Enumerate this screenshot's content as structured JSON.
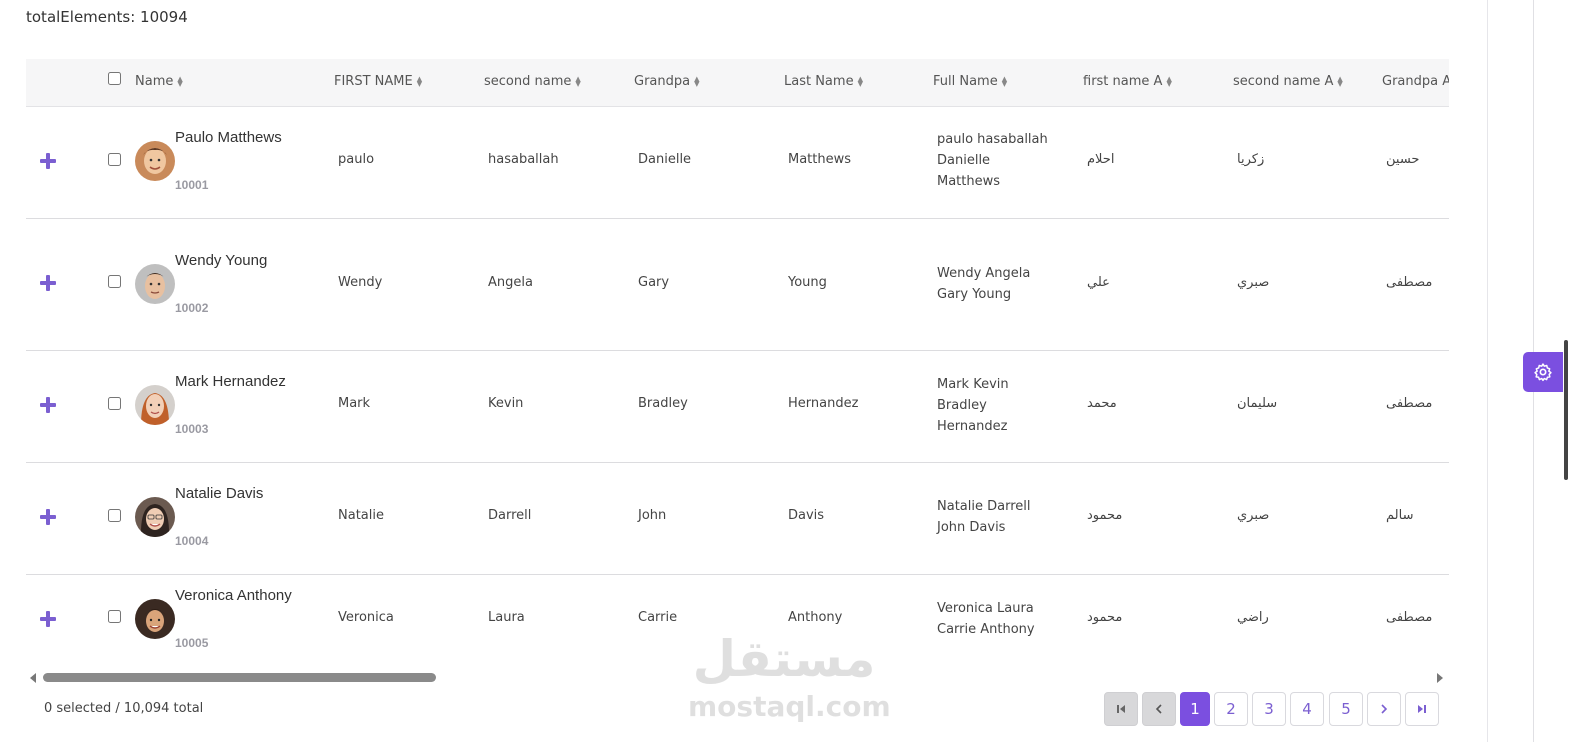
{
  "summary": {
    "total_elements": "totalElements: 10094"
  },
  "table": {
    "columns": [
      {
        "label": "Name"
      },
      {
        "label": "FIRST NAME"
      },
      {
        "label": "second name"
      },
      {
        "label": "Grandpa"
      },
      {
        "label": "Last Name"
      },
      {
        "label": "Full Name"
      },
      {
        "label": "first name A"
      },
      {
        "label": "second name A"
      },
      {
        "label": "Grandpa A"
      }
    ],
    "rows": [
      {
        "name": "Paulo Matthews",
        "id": "10001",
        "first": "paulo",
        "second": "hasaballah",
        "grandpa": "Danielle",
        "last": "Matthews",
        "full": "paulo hasaballah Danielle Matthews",
        "first_a": "احلام",
        "second_a": "زكريا",
        "grandpa_a": "حسين"
      },
      {
        "name": "Wendy Young",
        "id": "10002",
        "first": "Wendy",
        "second": "Angela",
        "grandpa": "Gary",
        "last": "Young",
        "full": "Wendy Angela Gary Young",
        "first_a": "علي",
        "second_a": "صبري",
        "grandpa_a": "مصطفى"
      },
      {
        "name": "Mark Hernandez",
        "id": "10003",
        "first": "Mark",
        "second": "Kevin",
        "grandpa": "Bradley",
        "last": "Hernandez",
        "full": "Mark Kevin Bradley Hernandez",
        "first_a": "محمد",
        "second_a": "سليمان",
        "grandpa_a": "مصطفى"
      },
      {
        "name": "Natalie Davis",
        "id": "10004",
        "first": "Natalie",
        "second": "Darrell",
        "grandpa": "John",
        "last": "Davis",
        "full": "Natalie Darrell John Davis",
        "first_a": "محمود",
        "second_a": "صبري",
        "grandpa_a": "سالم"
      },
      {
        "name": "Veronica Anthony",
        "id": "10005",
        "first": "Veronica",
        "second": "Laura",
        "grandpa": "Carrie",
        "last": "Anthony",
        "full": "Veronica Laura Carrie Anthony",
        "first_a": "محمود",
        "second_a": "راضي",
        "grandpa_a": "مصطفى"
      }
    ]
  },
  "footer": {
    "selection": "0 selected / 10,094 total"
  },
  "pagination": {
    "pages": [
      "1",
      "2",
      "3",
      "4",
      "5"
    ],
    "current": "1"
  },
  "watermark": {
    "arabic": "مستقل",
    "latin": "mostaql.com"
  },
  "colors": {
    "accent": "#7b4fe0",
    "plus": "#7b5fd1"
  },
  "icons": {
    "settings": "gear-icon",
    "expand": "plus-icon"
  }
}
